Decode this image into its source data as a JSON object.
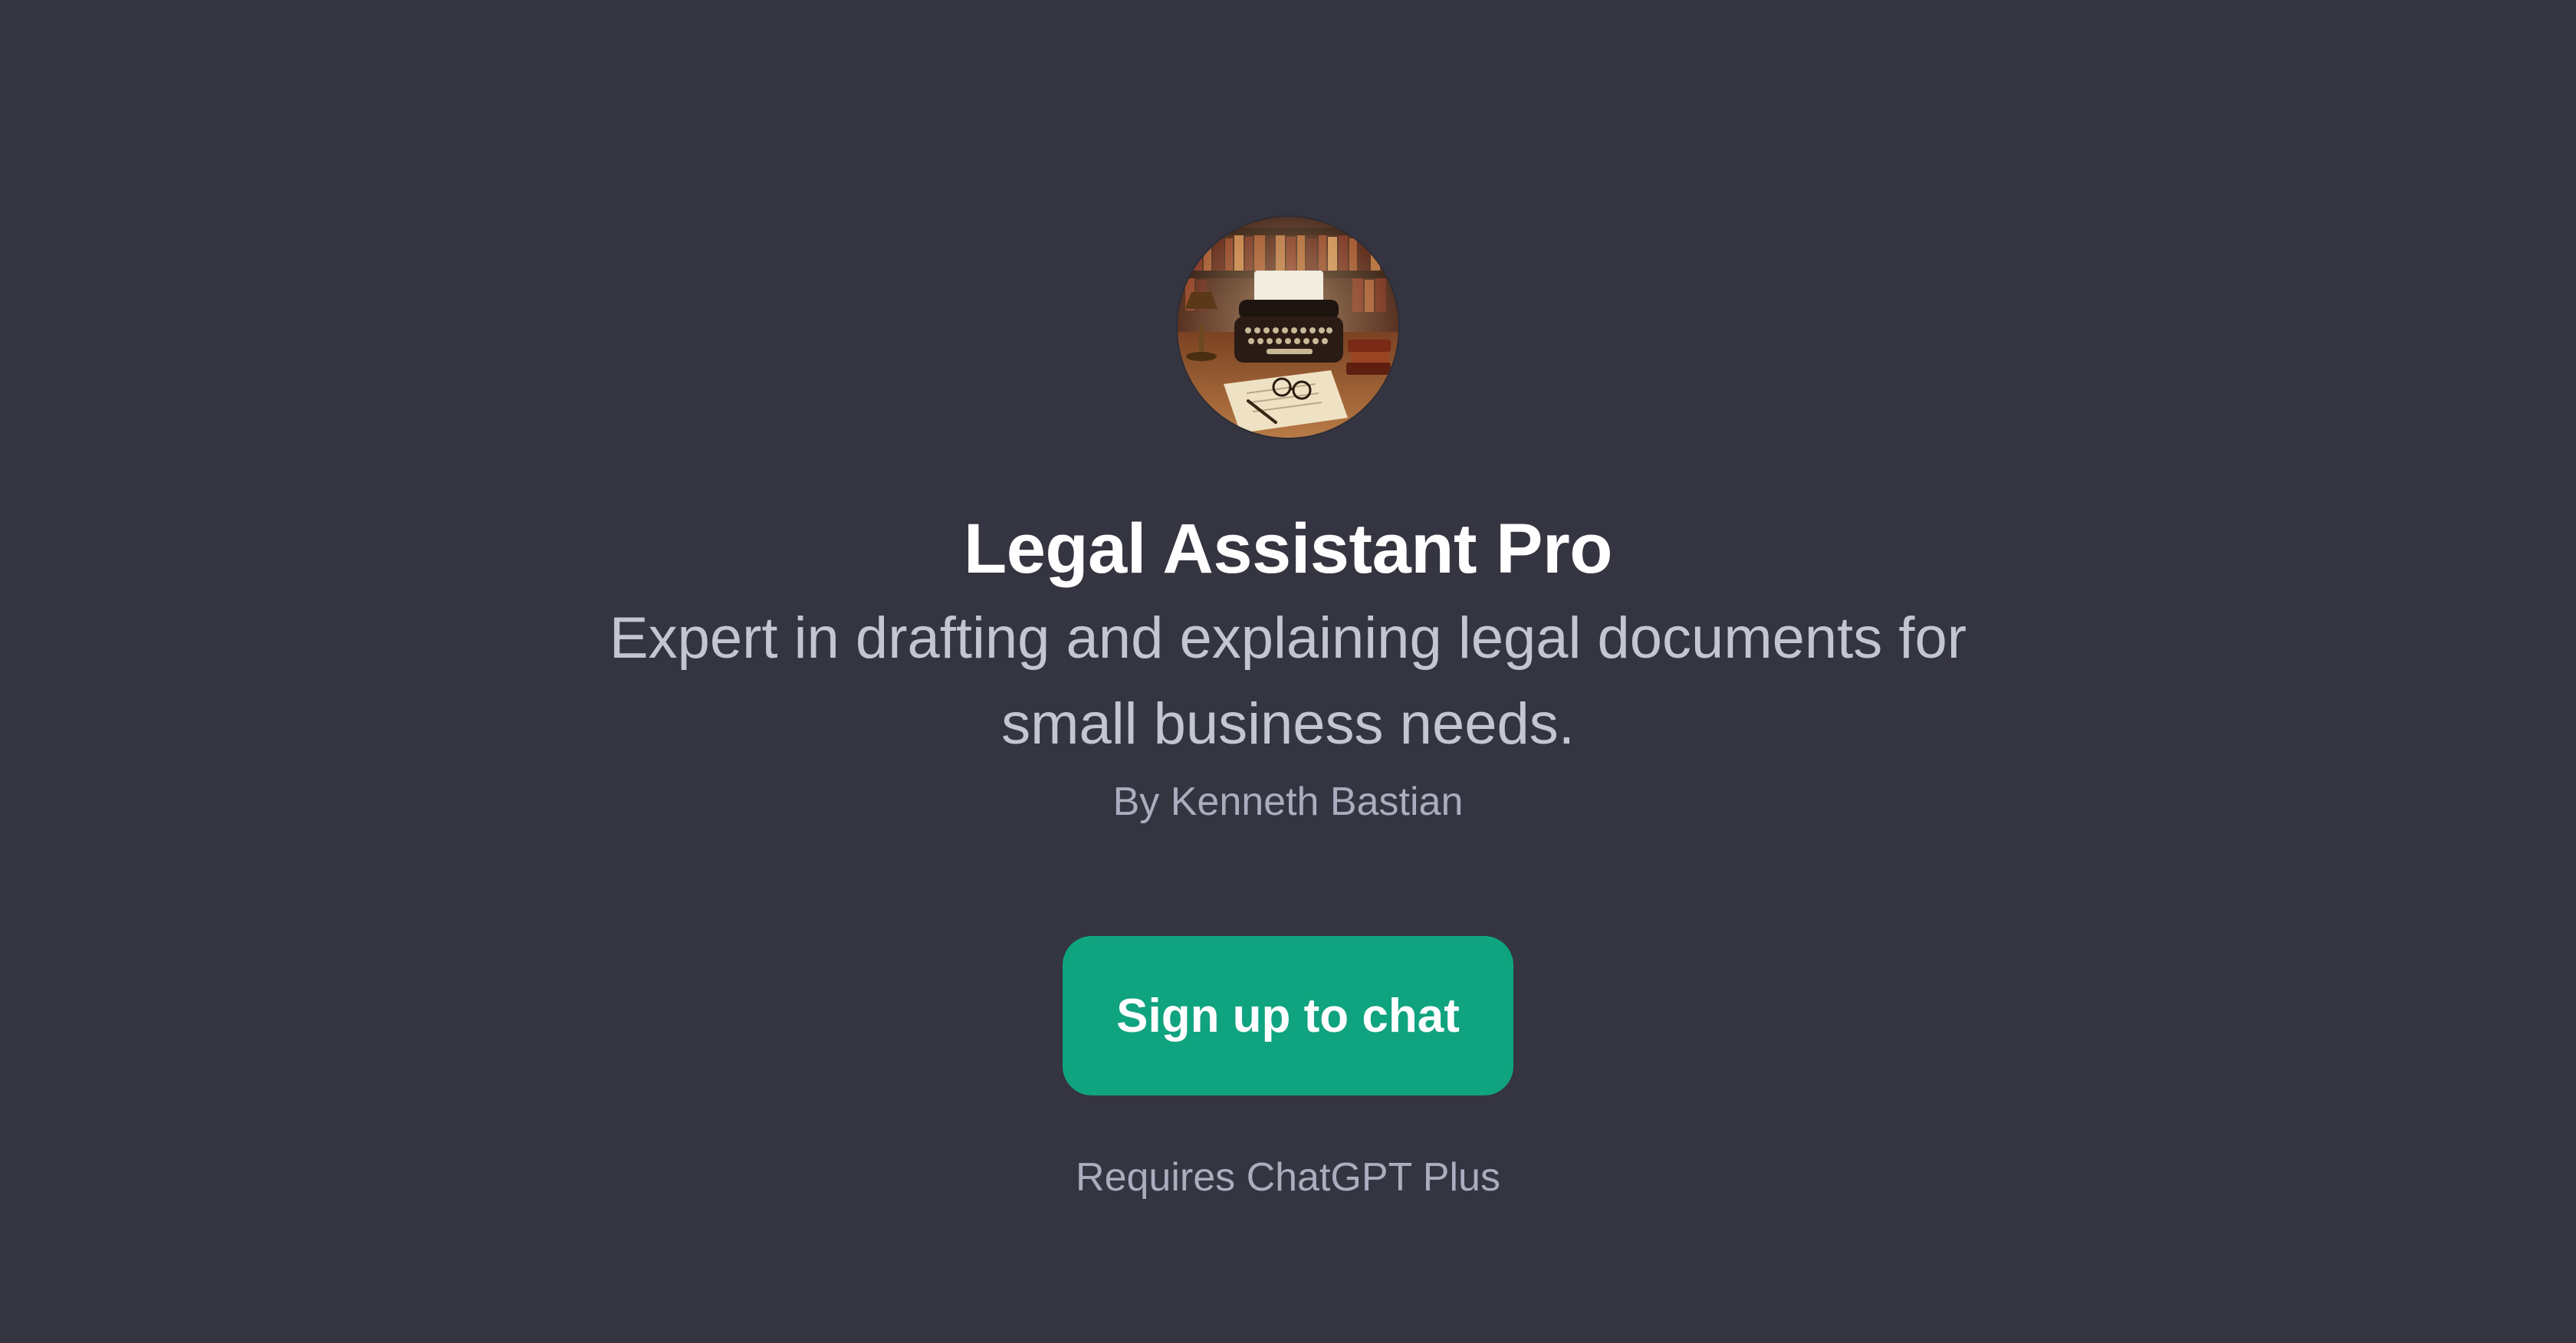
{
  "gpt": {
    "avatar_icon": "typewriter-law-library-image",
    "name": "Legal Assistant Pro",
    "description": "Expert in drafting and explaining legal documents for small business needs.",
    "author": "By Kenneth Bastian"
  },
  "cta": {
    "label": "Sign up to chat"
  },
  "footer": {
    "requirement": "Requires ChatGPT Plus"
  },
  "colors": {
    "background": "#343541",
    "title": "#ffffff",
    "description": "#c5c5d2",
    "muted": "#acacbe",
    "button": "#10a37f",
    "button_text": "#ffffff"
  }
}
